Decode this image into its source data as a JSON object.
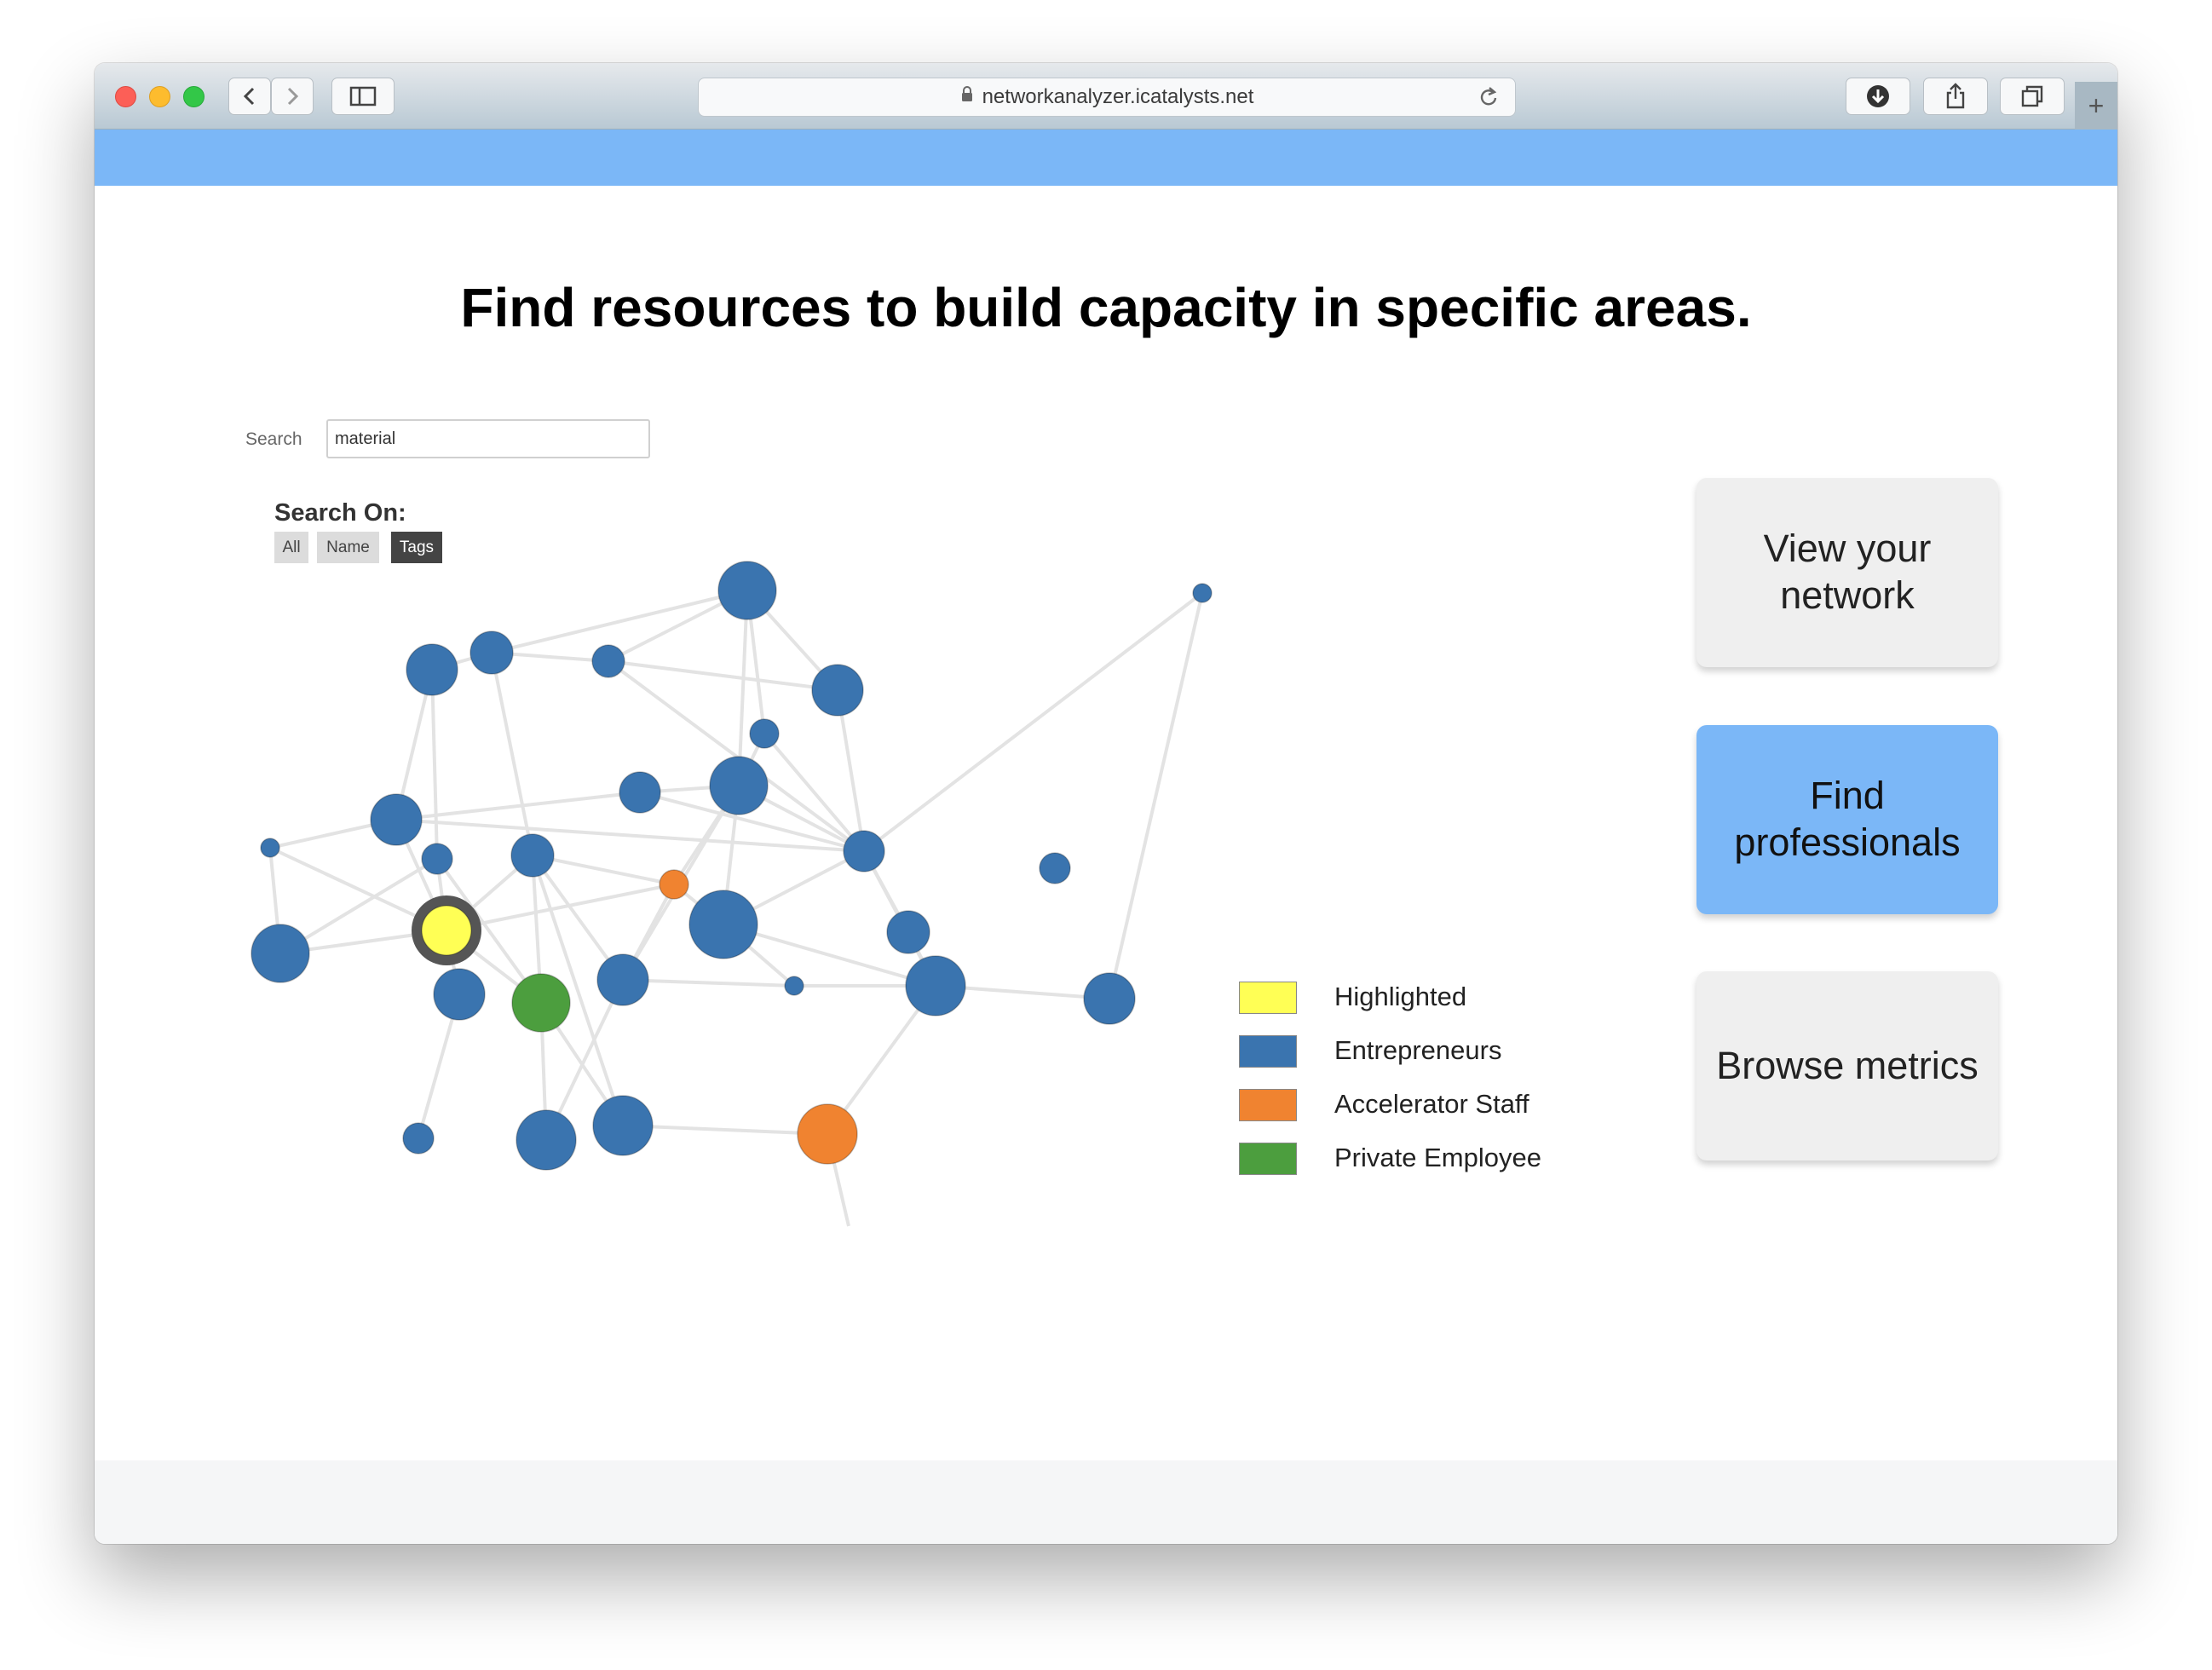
{
  "browser": {
    "url": "networkanalyzer.icatalysts.net"
  },
  "page": {
    "headline": "Find resources to build capacity in specific areas."
  },
  "search": {
    "label": "Search",
    "value": "material",
    "search_on_label": "Search On:",
    "options": [
      "All",
      "Name",
      "Tags"
    ],
    "selected": "Tags"
  },
  "legend": [
    {
      "label": "Highlighted",
      "color": "#ffff55"
    },
    {
      "label": "Entrepreneurs",
      "color": "#3a74af"
    },
    {
      "label": "Accelerator Staff",
      "color": "#f08330"
    },
    {
      "label": "Private Employee",
      "color": "#4c9e3e"
    }
  ],
  "actions": {
    "view_network": "View your network",
    "find_professionals": "Find professionals",
    "browse_metrics": "Browse metrics"
  }
}
